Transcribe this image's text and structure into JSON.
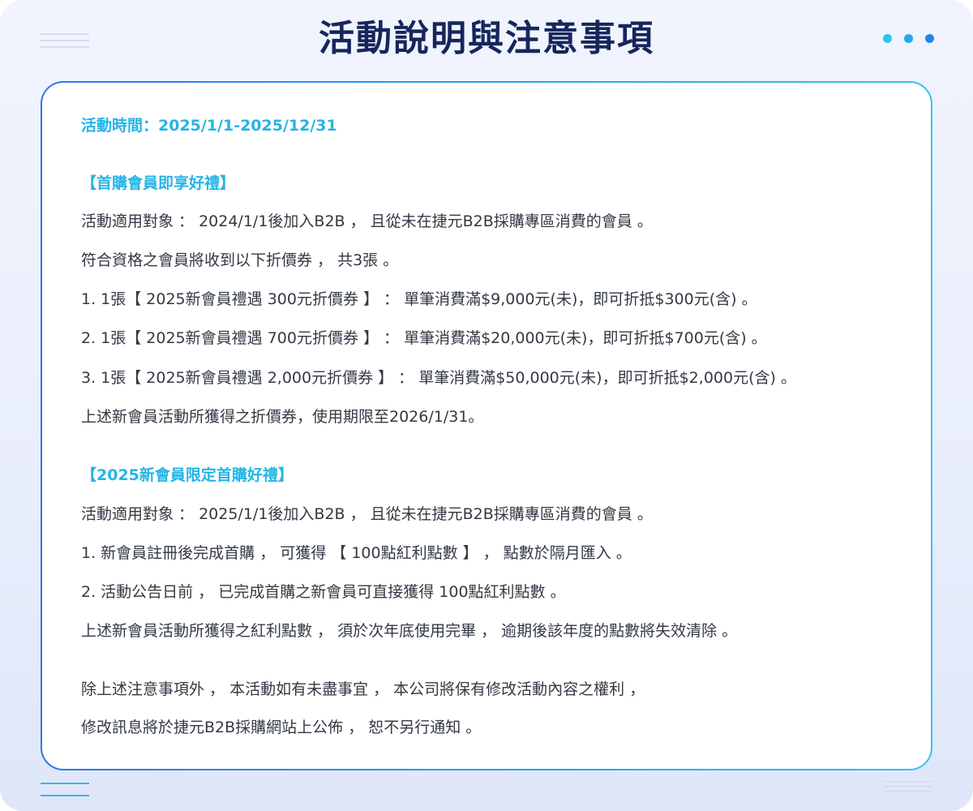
{
  "page": {
    "title": "活動說明與注意事項"
  },
  "colors": {
    "title": "#16265c",
    "accent": "#26b4e5",
    "body_text": "#333944",
    "card_border_start": "#2a79e6",
    "card_border_end": "#33c3ee"
  },
  "content": {
    "period": "活動時間：2025/1/1-2025/12/31",
    "section1": {
      "heading": "【首購會員即享好禮】",
      "lines": [
        "活動適用對象 ： 2024/1/1後加入B2B ， 且從未在捷元B2B採購專區消費的會員 。",
        "符合資格之會員將收到以下折價券 ， 共3張 。",
        "1. 1張【  2025新會員禮遇 300元折價券 】 ： 單筆消費滿$9,000元(未)，即可折抵$300元(含) 。",
        "2. 1張【 2025新會員禮遇 700元折價券 】 ： 單筆消費滿$20,000元(未)，即可折抵$700元(含) 。",
        "3. 1張【 2025新會員禮遇 2,000元折價券 】 ： 單筆消費滿$50,000元(未)，即可折抵$2,000元(含) 。",
        "上述新會員活動所獲得之折價券，使用期限至2026/1/31。"
      ]
    },
    "section2": {
      "heading": "【2025新會員限定首購好禮】",
      "lines": [
        "活動適用對象 ： 2025/1/1後加入B2B ， 且從未在捷元B2B採購專區消費的會員 。",
        "1. 新會員註冊後完成首購 ， 可獲得 【 100點紅利點數 】 ， 點數於隔月匯入 。",
        "2. 活動公告日前 ， 已完成首購之新會員可直接獲得 100點紅利點數 。",
        "上述新會員活動所獲得之紅利點數 ， 須於次年底使用完畢 ， 逾期後該年度的點數將失效清除 。"
      ]
    },
    "notice": {
      "lines": [
        "除上述注意事項外 ， 本活動如有未盡事宜 ， 本公司將保有修改活動內容之權利 ，",
        "修改訊息將於捷元B2B採購網站上公佈 ， 恕不另行通知 。"
      ]
    }
  }
}
